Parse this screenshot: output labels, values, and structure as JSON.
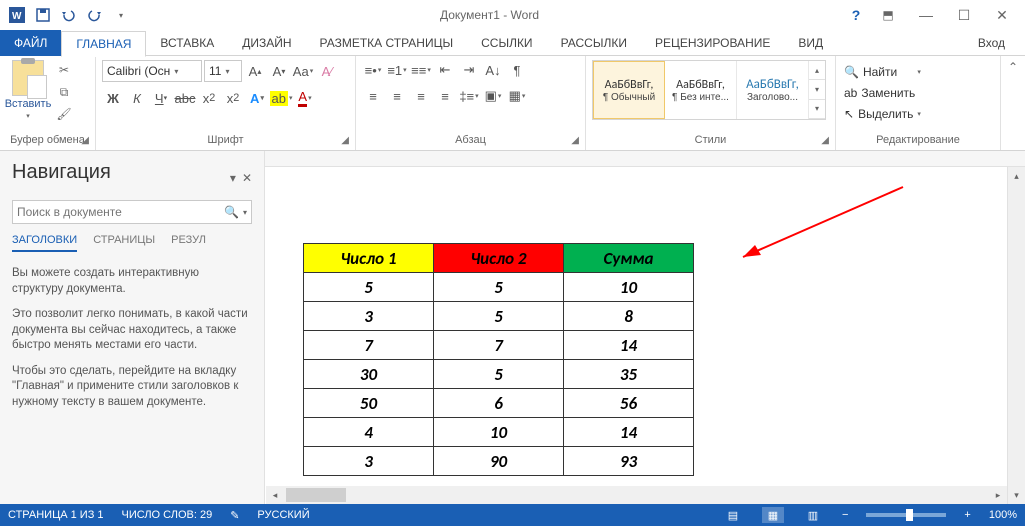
{
  "window": {
    "title": "Документ1 - Word",
    "login": "Вход"
  },
  "tabs": {
    "file": "ФАЙЛ",
    "home": "ГЛАВНАЯ",
    "insert": "ВСТАВКА",
    "design": "ДИЗАЙН",
    "layout": "РАЗМЕТКА СТРАНИЦЫ",
    "references": "ССЫЛКИ",
    "mailings": "РАССЫЛКИ",
    "review": "РЕЦЕНЗИРОВАНИЕ",
    "view": "ВИД"
  },
  "ribbon": {
    "clipboard": {
      "paste": "Вставить",
      "title": "Буфер обмена"
    },
    "font": {
      "name": "Calibri (Осн",
      "size": "11",
      "title": "Шрифт"
    },
    "paragraph": {
      "title": "Абзац"
    },
    "styles": {
      "title": "Стили",
      "sample": "АаБбВвГг,",
      "normal": "¶ Обычный",
      "nospacing": "¶ Без инте...",
      "heading1": "Заголово..."
    },
    "editing": {
      "title": "Редактирование",
      "find": "Найти",
      "replace": "Заменить",
      "select": "Выделить"
    }
  },
  "nav": {
    "title": "Навигация",
    "search_placeholder": "Поиск в документе",
    "tab_headings": "ЗАГОЛОВКИ",
    "tab_pages": "СТРАНИЦЫ",
    "tab_results": "РЕЗУЛ",
    "help1": "Вы можете создать интерактивную структуру документа.",
    "help2": "Это позволит легко понимать, в какой части документа вы сейчас находитесь, а также быстро менять местами его части.",
    "help3": "Чтобы это сделать, перейдите на вкладку \"Главная\" и примените стили заголовков к нужному тексту в вашем документе."
  },
  "table": {
    "headers": [
      "Число 1",
      "Число 2",
      "Сумма"
    ],
    "rows": [
      [
        "5",
        "5",
        "10"
      ],
      [
        "3",
        "5",
        "8"
      ],
      [
        "7",
        "7",
        "14"
      ],
      [
        "30",
        "5",
        "35"
      ],
      [
        "50",
        "6",
        "56"
      ],
      [
        "4",
        "10",
        "14"
      ],
      [
        "3",
        "90",
        "93"
      ]
    ]
  },
  "status": {
    "page": "СТРАНИЦА 1 ИЗ 1",
    "words": "ЧИСЛО СЛОВ: 29",
    "lang": "РУССКИЙ",
    "zoom": "100%"
  }
}
